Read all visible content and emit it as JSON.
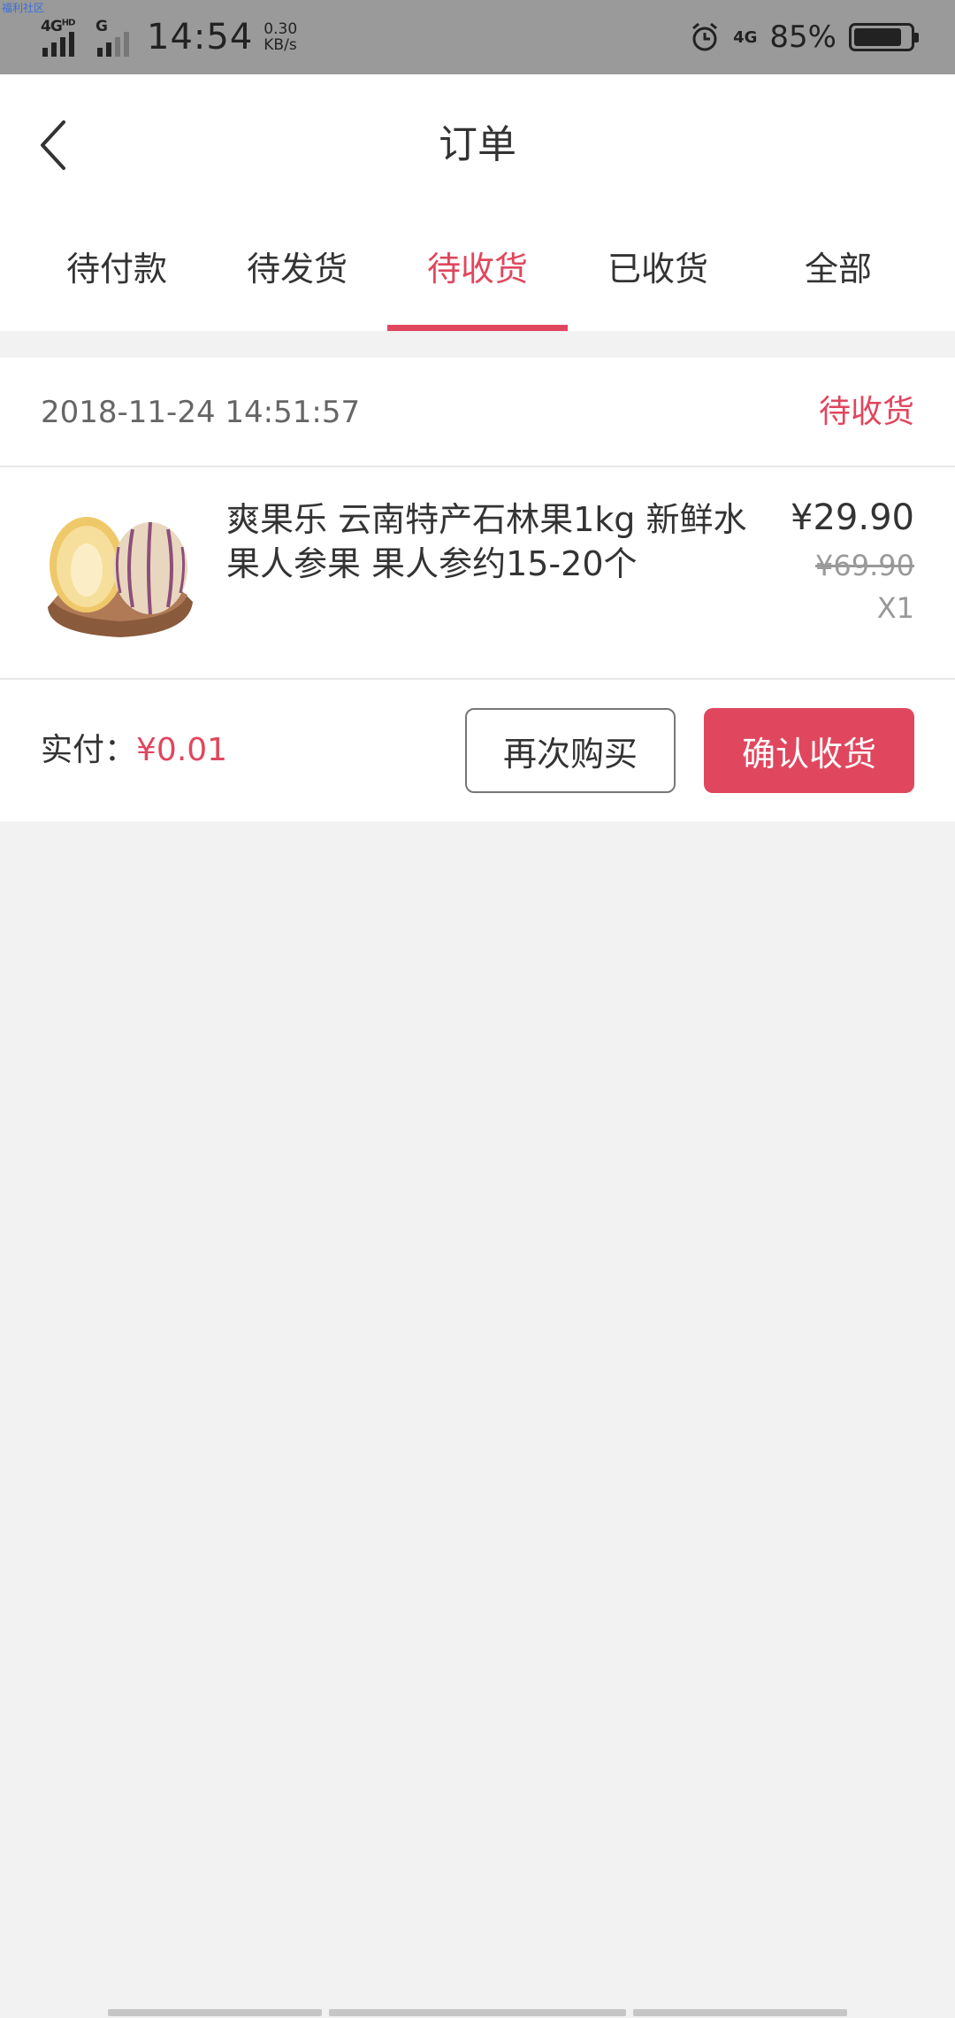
{
  "status_bar": {
    "corner_text": "福利社区",
    "network_left": "4G",
    "network_left_sup": "HD",
    "network_second": "G",
    "time": "14:54",
    "speed_value": "0.30",
    "speed_unit": "KB/s",
    "network_right": "4G",
    "battery_pct": "85%",
    "battery_level": 0.85
  },
  "header": {
    "title": "订单",
    "tabs": [
      {
        "label": "待付款",
        "active": false
      },
      {
        "label": "待发货",
        "active": false
      },
      {
        "label": "待收货",
        "active": true
      },
      {
        "label": "已收货",
        "active": false
      },
      {
        "label": "全部",
        "active": false
      }
    ]
  },
  "order": {
    "date": "2018-11-24 14:51:57",
    "status": "待收货",
    "item": {
      "name": "爽果乐 云南特产石林果1kg 新鲜水果人参果 果人参约15-20个",
      "price": "¥29.90",
      "original_price": "¥69.90",
      "quantity": "X1"
    },
    "paid_label": "实付：",
    "paid_amount": "¥0.01",
    "rebuy_label": "再次购买",
    "confirm_label": "确认收货"
  },
  "colors": {
    "accent": "#e0475e",
    "status_bar_bg": "#9a9a9a",
    "page_bg": "#f2f2f2"
  }
}
